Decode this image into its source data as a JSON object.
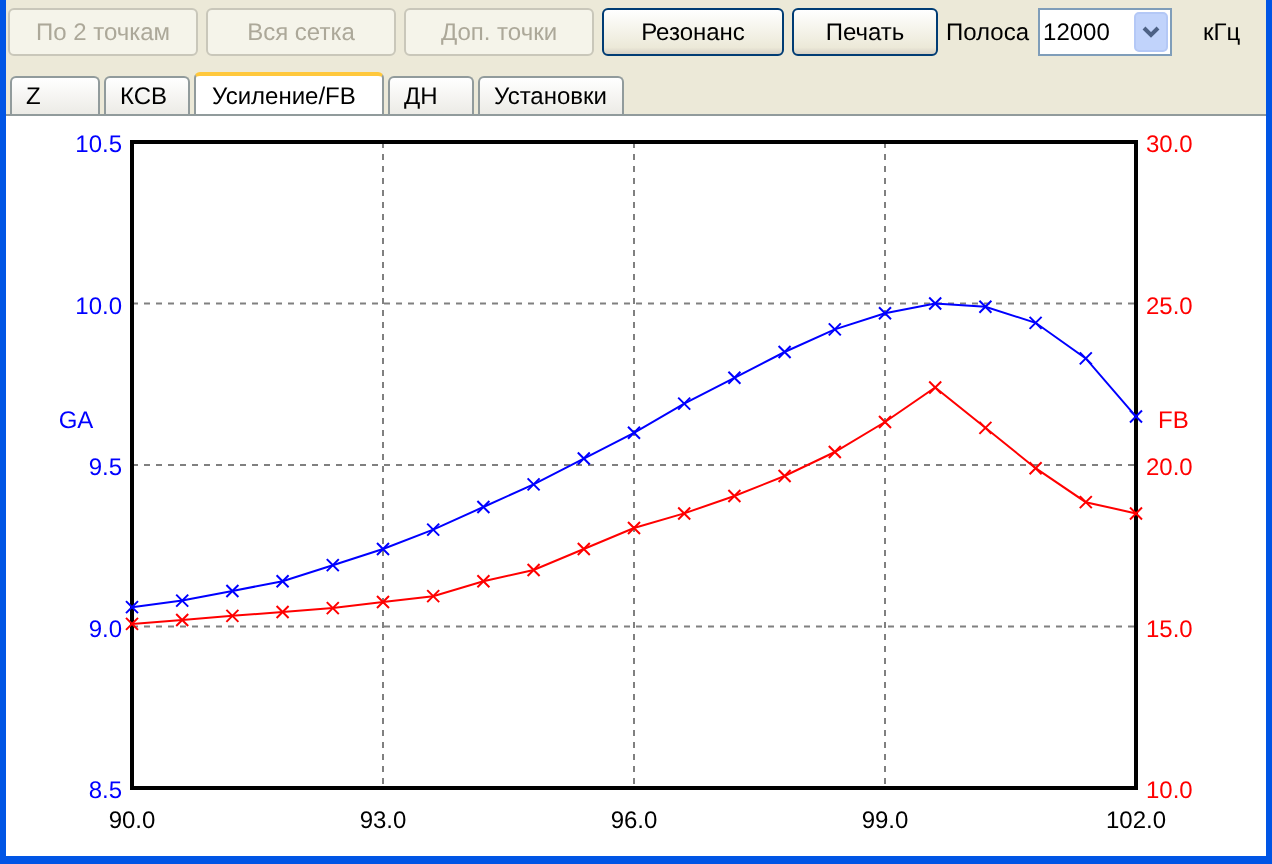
{
  "toolbar": {
    "buttons": [
      {
        "label": "По 2 точкам",
        "disabled": true
      },
      {
        "label": "Вся сетка",
        "disabled": true
      },
      {
        "label": "Доп. точки",
        "disabled": true
      },
      {
        "label": "Резонанс",
        "disabled": false
      },
      {
        "label": "Печать",
        "disabled": false
      }
    ],
    "band": {
      "label": "Полоса",
      "value": "12000",
      "unit": "кГц"
    }
  },
  "tabs": [
    {
      "label": "Z",
      "selected": false
    },
    {
      "label": "КСВ",
      "selected": false
    },
    {
      "label": "Усиление/FB",
      "selected": true
    },
    {
      "label": "ДН",
      "selected": false
    },
    {
      "label": "Установки",
      "selected": false
    }
  ],
  "chart_data": {
    "type": "line",
    "grid": true,
    "x": [
      90.0,
      90.6,
      91.2,
      91.8,
      92.4,
      93.0,
      93.6,
      94.2,
      94.8,
      95.4,
      96.0,
      96.6,
      97.2,
      97.8,
      98.4,
      99.0,
      99.6,
      100.2,
      100.8,
      101.4,
      102.0
    ],
    "xlim": [
      90,
      102
    ],
    "xticks": [
      {
        "value": 90,
        "label": "90.0"
      },
      {
        "value": 93,
        "label": "93.0"
      },
      {
        "value": 96,
        "label": "96.0"
      },
      {
        "value": 99,
        "label": "99.0"
      },
      {
        "value": 102,
        "label": "102.0"
      }
    ],
    "ylim": [
      8.5,
      10.5
    ],
    "yticks": [
      {
        "value": 8.5,
        "label": "8.5"
      },
      {
        "value": 9,
        "label": "9.0"
      },
      {
        "value": 9.5,
        "label": "9.5"
      },
      {
        "value": 10,
        "label": "10.0"
      },
      {
        "value": 10.5,
        "label": "10.5"
      }
    ],
    "y2lim": [
      10,
      30
    ],
    "y2ticks": [
      {
        "value": 10,
        "label": "10.0"
      },
      {
        "value": 15,
        "label": "15.0"
      },
      {
        "value": 20,
        "label": "20.0"
      },
      {
        "value": 25,
        "label": "25.0"
      },
      {
        "value": 30,
        "label": "30.0"
      }
    ],
    "series": [
      {
        "name": "GA",
        "color": "#0000ff",
        "marker": "x",
        "values": [
          9.06,
          9.08,
          9.11,
          9.14,
          9.19,
          9.24,
          9.3,
          9.37,
          9.44,
          9.52,
          9.6,
          9.69,
          9.77,
          9.85,
          9.92,
          9.97,
          10.0,
          9.99,
          9.94,
          9.83,
          9.65
        ]
      },
      {
        "name": "FB",
        "color": "#ff0000",
        "axis": "y2",
        "marker": "x",
        "values": [
          15.08,
          15.2,
          15.33,
          15.45,
          15.57,
          15.76,
          15.94,
          16.4,
          16.75,
          17.4,
          18.05,
          18.5,
          19.04,
          19.66,
          20.4,
          21.33,
          22.4,
          21.15,
          19.9,
          18.85,
          18.5
        ]
      }
    ]
  }
}
